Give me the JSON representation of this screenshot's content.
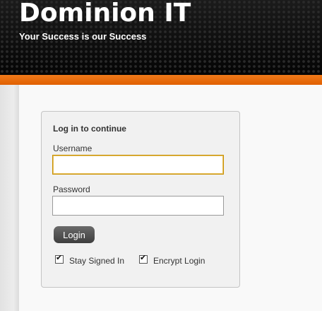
{
  "header": {
    "title": "Dominion IT",
    "tagline": "Your Success is our Success"
  },
  "login": {
    "heading": "Log in to continue",
    "username_label": "Username",
    "username_value": "",
    "password_label": "Password",
    "password_value": "",
    "button_label": "Login",
    "stay_signed_in_label": "Stay Signed In",
    "stay_signed_in_checked": true,
    "encrypt_login_label": "Encrypt Login",
    "encrypt_login_checked": true
  },
  "colors": {
    "header_bg": "#111111",
    "accent": "#e86a0c",
    "button_bg": "#4f4f4f",
    "focus_border": "#c99100"
  },
  "icons": {
    "checkbox_checked": "check-icon"
  }
}
